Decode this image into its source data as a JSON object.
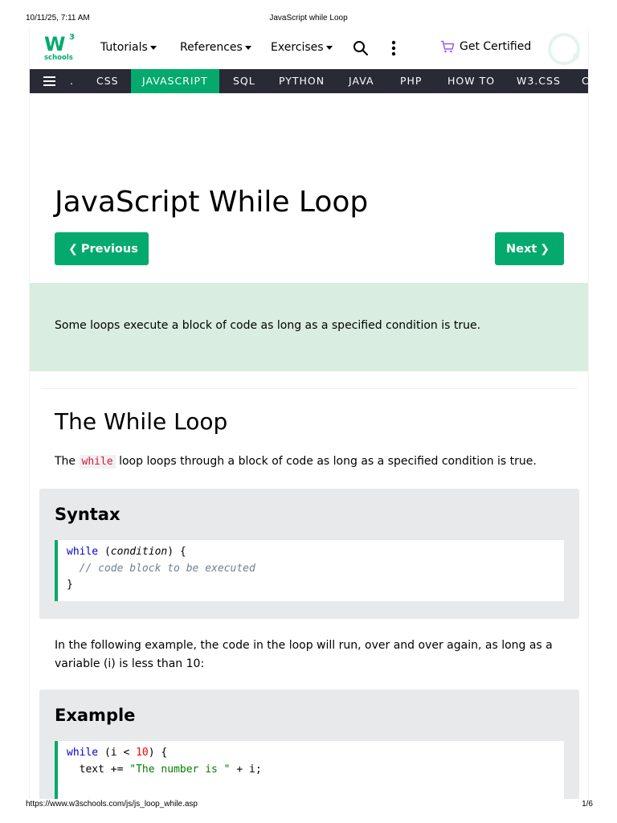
{
  "print_header": {
    "datetime": "10/11/25, 7:11 AM",
    "doc_title": "JavaScript while Loop"
  },
  "print_footer": {
    "url": "https://www.w3schools.com/js/js_loop_while.asp",
    "page": "1/6"
  },
  "logo": {
    "mark": "W",
    "superscript": "3",
    "text": "schools"
  },
  "topnav": {
    "tutorials": "Tutorials",
    "references": "References",
    "exercises": "Exercises",
    "get_certified": "Get Certified"
  },
  "topics": {
    "partial_left": ".",
    "items": [
      "CSS",
      "JAVASCRIPT",
      "SQL",
      "PYTHON",
      "JAVA",
      "PHP",
      "HOW TO",
      "W3.CSS",
      "C"
    ],
    "active": "JAVASCRIPT"
  },
  "main": {
    "title": "JavaScript While Loop",
    "prev_label": "Previous",
    "next_label": "Next",
    "intro": "Some loops execute a block of code as long as a specified condition is true.",
    "section_heading": "The While Loop",
    "section_text_before": "The",
    "section_code_word": "while",
    "section_text_after": "loop loops through a block of code as long as a specified condition is true.",
    "syntax": {
      "heading": "Syntax",
      "line1_kw": "while",
      "line1_open": " (",
      "line1_cond": "condition",
      "line1_close": ") {",
      "line2_comment": "// code block to be executed",
      "line3": "}"
    },
    "example_intro_1": "In the following example, the code in the loop will run, over and over again, as long as a",
    "example_intro_2": "variable (i) is less than 10:",
    "example": {
      "heading": "Example",
      "line1_kw": "while",
      "line1_mid": " (i < ",
      "line1_num": "10",
      "line1_end": ") {",
      "line2_start": "  text += ",
      "line2_str": "\"The number is \"",
      "line2_end": " + i;"
    }
  },
  "colors": {
    "accent": "#04AA6D",
    "topic_bar": "#282A35",
    "intro_bg": "#D9EEE1",
    "panel_bg": "#E7E9EB",
    "cert_cart": "#8B5CF6"
  }
}
